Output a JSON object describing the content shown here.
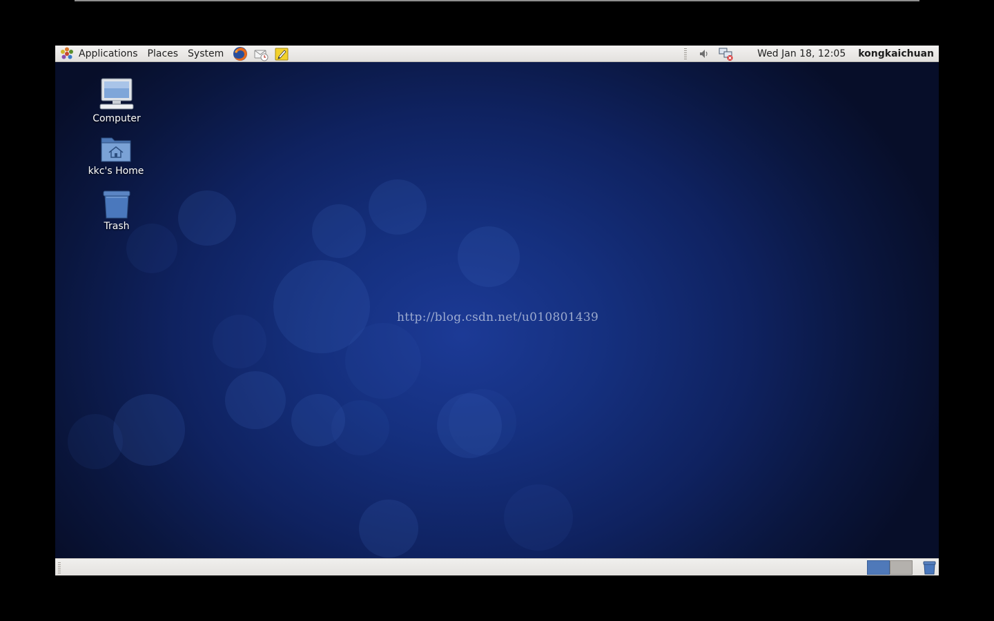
{
  "top_panel": {
    "menus": {
      "applications": "Applications",
      "places": "Places",
      "system": "System"
    },
    "launchers": [
      "firefox-icon",
      "email-icon",
      "notes-icon"
    ],
    "tray": [
      "volume-icon",
      "network-disconnected-icon"
    ],
    "clock": "Wed Jan 18, 12:05",
    "user": "kongkaichuan"
  },
  "desktop": {
    "icons": {
      "computer": "Computer",
      "home": "kkc's Home",
      "trash": "Trash"
    },
    "watermark": "http://blog.csdn.net/u010801439"
  },
  "bottom_panel": {
    "workspaces": 2,
    "active_workspace": 1
  },
  "colors": {
    "panel": "#e9e7e4",
    "desktop": "#15307f",
    "workspace_active": "#4f79b9"
  }
}
